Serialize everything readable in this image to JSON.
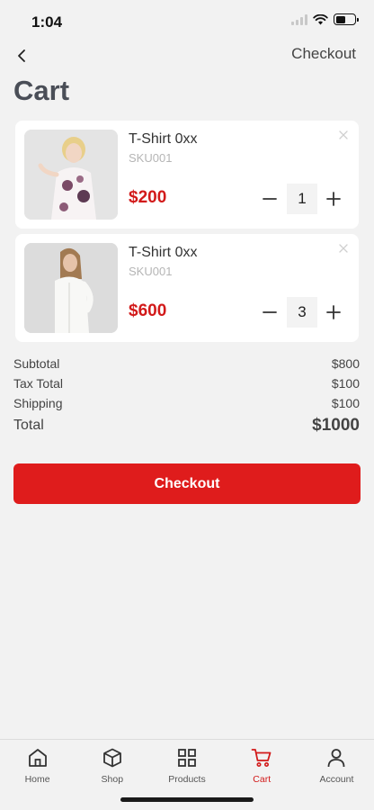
{
  "status": {
    "time": "1:04"
  },
  "header": {
    "action_label": "Checkout",
    "title": "Cart"
  },
  "cart": {
    "items": [
      {
        "name": "T-Shirt 0xx",
        "sku": "SKU001",
        "price": "$200",
        "quantity": "1"
      },
      {
        "name": "T-Shirt 0xx",
        "sku": "SKU001",
        "price": "$600",
        "quantity": "3"
      }
    ]
  },
  "summary": {
    "subtotal_label": "Subtotal",
    "subtotal_value": "$800",
    "tax_label": "Tax Total",
    "tax_value": "$100",
    "shipping_label": "Shipping",
    "shipping_value": "$100",
    "total_label": "Total",
    "total_value": "$1000"
  },
  "checkout_button": {
    "label": "Checkout"
  },
  "tabs": [
    {
      "label": "Home",
      "icon": "home-icon"
    },
    {
      "label": "Shop",
      "icon": "cube-icon"
    },
    {
      "label": "Products",
      "icon": "grid-icon"
    },
    {
      "label": "Cart",
      "icon": "cart-icon",
      "active": true
    },
    {
      "label": "Account",
      "icon": "user-icon"
    }
  ],
  "colors": {
    "accent": "#df1c1c",
    "price": "#d21a1a",
    "background": "#f2f2f2"
  }
}
